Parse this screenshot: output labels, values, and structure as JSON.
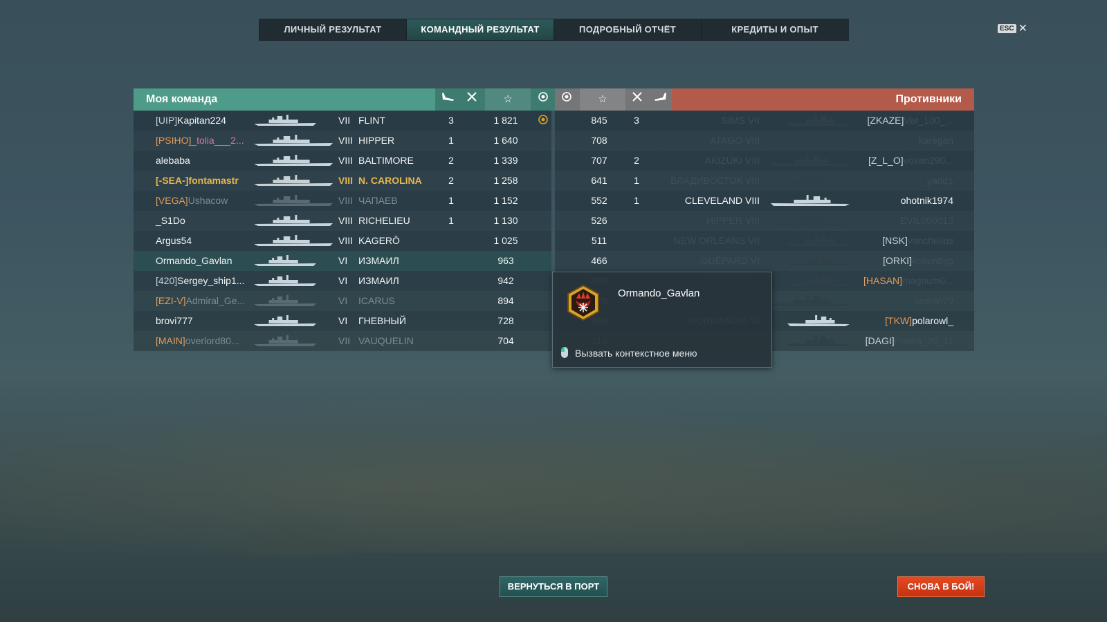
{
  "tabs": [
    {
      "label": "ЛИЧНЫЙ РЕЗУЛЬТАТ"
    },
    {
      "label": "КОМАНДНЫЙ РЕЗУЛЬТАТ",
      "active": true
    },
    {
      "label": "ПОДРОБНЫЙ ОТЧЁТ"
    },
    {
      "label": "КРЕДИТЫ И ОПЫТ"
    }
  ],
  "close": {
    "key_label": "ESC",
    "icon": "close-icon"
  },
  "my_team": {
    "title": "Моя команда",
    "header_icons": [
      "plane-kill-icon",
      "frag-icon",
      "star-icon",
      "emblem-icon"
    ],
    "rows": [
      {
        "clan": "[UIP]",
        "name": "Kapitan224",
        "tier": "VII",
        "ship": "FLINT",
        "planes": "3",
        "frags": "",
        "exp": "1 821",
        "emblem": true,
        "style": "normal"
      },
      {
        "clan": "[PSIHO]",
        "name": "_tolia___2...",
        "tier": "VIII",
        "ship": "HIPPER",
        "planes": "1",
        "frags": "",
        "exp": "1 640",
        "style": "pink"
      },
      {
        "clan": "",
        "name": "alebaba",
        "tier": "VIII",
        "ship": "BALTIMORE",
        "planes": "2",
        "frags": "",
        "exp": "1 339",
        "style": "normal"
      },
      {
        "clan": "[-SEA-]",
        "name": "fontamastr",
        "tier": "VIII",
        "ship": "N. CAROLINA",
        "planes": "2",
        "frags": "",
        "exp": "1 258",
        "style": "gold"
      },
      {
        "clan": "[VEGA]",
        "name": "Ushacow",
        "tier": "VIII",
        "ship": "ЧАПАЕВ",
        "planes": "1",
        "frags": "",
        "exp": "1 152",
        "style": "dead"
      },
      {
        "clan": "",
        "name": "_S1Do",
        "tier": "VIII",
        "ship": "RICHELIEU",
        "planes": "1",
        "frags": "",
        "exp": "1 130",
        "style": "normal"
      },
      {
        "clan": "",
        "name": "Argus54",
        "tier": "VIII",
        "ship": "KAGERŌ",
        "planes": "",
        "frags": "",
        "exp": "1 025",
        "style": "normal"
      },
      {
        "clan": "",
        "name": "Ormando_Gavlan",
        "tier": "VI",
        "ship": "ИЗМАИЛ",
        "planes": "",
        "frags": "",
        "exp": "963",
        "style": "selected"
      },
      {
        "clan": "[420]",
        "name": "Sergey_ship1...",
        "tier": "VI",
        "ship": "ИЗМАИЛ",
        "planes": "",
        "frags": "",
        "exp": "942",
        "style": "normal"
      },
      {
        "clan": "[EZI-V]",
        "name": "Admiral_Ge...",
        "tier": "VI",
        "ship": "ICARUS",
        "planes": "",
        "frags": "",
        "exp": "894",
        "style": "dead"
      },
      {
        "clan": "",
        "name": "brovi777",
        "tier": "VI",
        "ship": "ГНЕВНЫЙ",
        "planes": "",
        "frags": "",
        "exp": "728",
        "style": "normal"
      },
      {
        "clan": "[MAIN]",
        "name": "overlord80...",
        "tier": "VII",
        "ship": "VAUQUELIN",
        "planes": "",
        "frags": "",
        "exp": "704",
        "style": "dead"
      }
    ]
  },
  "enemy_team": {
    "title": "Противники",
    "header_icons": [
      "emblem-icon",
      "star-icon",
      "frag-icon",
      "plane-kill-icon"
    ],
    "rows": [
      {
        "exp": "845",
        "frags": "3",
        "planes": "",
        "ship": "SIMS",
        "tier": "VII",
        "clan": "[ZKAZE]",
        "name": "Ver_100_...",
        "style": "dead"
      },
      {
        "exp": "708",
        "frags": "",
        "planes": "",
        "ship": "ATAGO",
        "tier": "VIII",
        "clan": "",
        "name": "karegan",
        "style": "dead"
      },
      {
        "exp": "707",
        "frags": "2",
        "planes": "",
        "ship": "AKIZUKI",
        "tier": "VIII",
        "clan": "[Z_L_O]",
        "name": "vovan290...",
        "style": "dead"
      },
      {
        "exp": "641",
        "frags": "1",
        "planes": "",
        "ship": "ВЛАДИВОСТОК",
        "tier": "VIII",
        "clan": "",
        "name": "yanq1",
        "style": "dead"
      },
      {
        "exp": "552",
        "frags": "1",
        "planes": "",
        "ship": "CLEVELAND",
        "tier": "VIII",
        "clan": "",
        "name": "ohotnik1974",
        "style": "alive"
      },
      {
        "exp": "526",
        "frags": "",
        "planes": "",
        "ship": "HIPPER",
        "tier": "VIII",
        "clan": "",
        "name": "EVIL000013",
        "style": "dead"
      },
      {
        "exp": "511",
        "frags": "",
        "planes": "",
        "ship": "NEW ORLEANS",
        "tier": "VII",
        "clan": "[NSK]",
        "name": "vanchelius",
        "style": "dead"
      },
      {
        "exp": "466",
        "frags": "",
        "planes": "",
        "ship": "GUÉPARD",
        "tier": "VI",
        "clan": "[ORKI]",
        "name": "kolambyp",
        "style": "dead"
      },
      {
        "exp": "390",
        "frags": "",
        "planes": "",
        "ship": "ИЗМАИЛ",
        "tier": "VI",
        "clan": "[HASAN]",
        "name": "magnum0...",
        "style": "dead-orange"
      },
      {
        "exp": "376",
        "frags": "",
        "planes": "",
        "ship": "BISMARCK",
        "tier": "VIII",
        "clan": "",
        "name": "sosnin79",
        "style": "dead"
      },
      {
        "exp": "368",
        "frags": "",
        "planes": "",
        "ship": "NORMANDIE",
        "tier": "VI",
        "clan": "[TKW]",
        "name": "polarowl_",
        "style": "alive-clan"
      },
      {
        "exp": "319",
        "frags": "",
        "planes": "",
        "ship": "GUÉPARD",
        "tier": "VI",
        "clan": "[DAGI]",
        "name": "Pasha_09_11",
        "style": "dead"
      }
    ]
  },
  "tooltip": {
    "player": "Ormando_Gavlan",
    "hint": "Вызвать контекстное меню",
    "badge_icon": "commander-badge-icon",
    "mouse_icon": "mouse-left-click-icon"
  },
  "buttons": {
    "port": "ВЕРНУТЬСЯ В ПОРТ",
    "battle": "СНОВА В БОЙ!"
  },
  "colors": {
    "my_team_header": "#4f9b8a",
    "enemy_team_header": "#b45a4a",
    "gold_highlight": "#e9b54a",
    "battle_button": "#e54a22"
  }
}
